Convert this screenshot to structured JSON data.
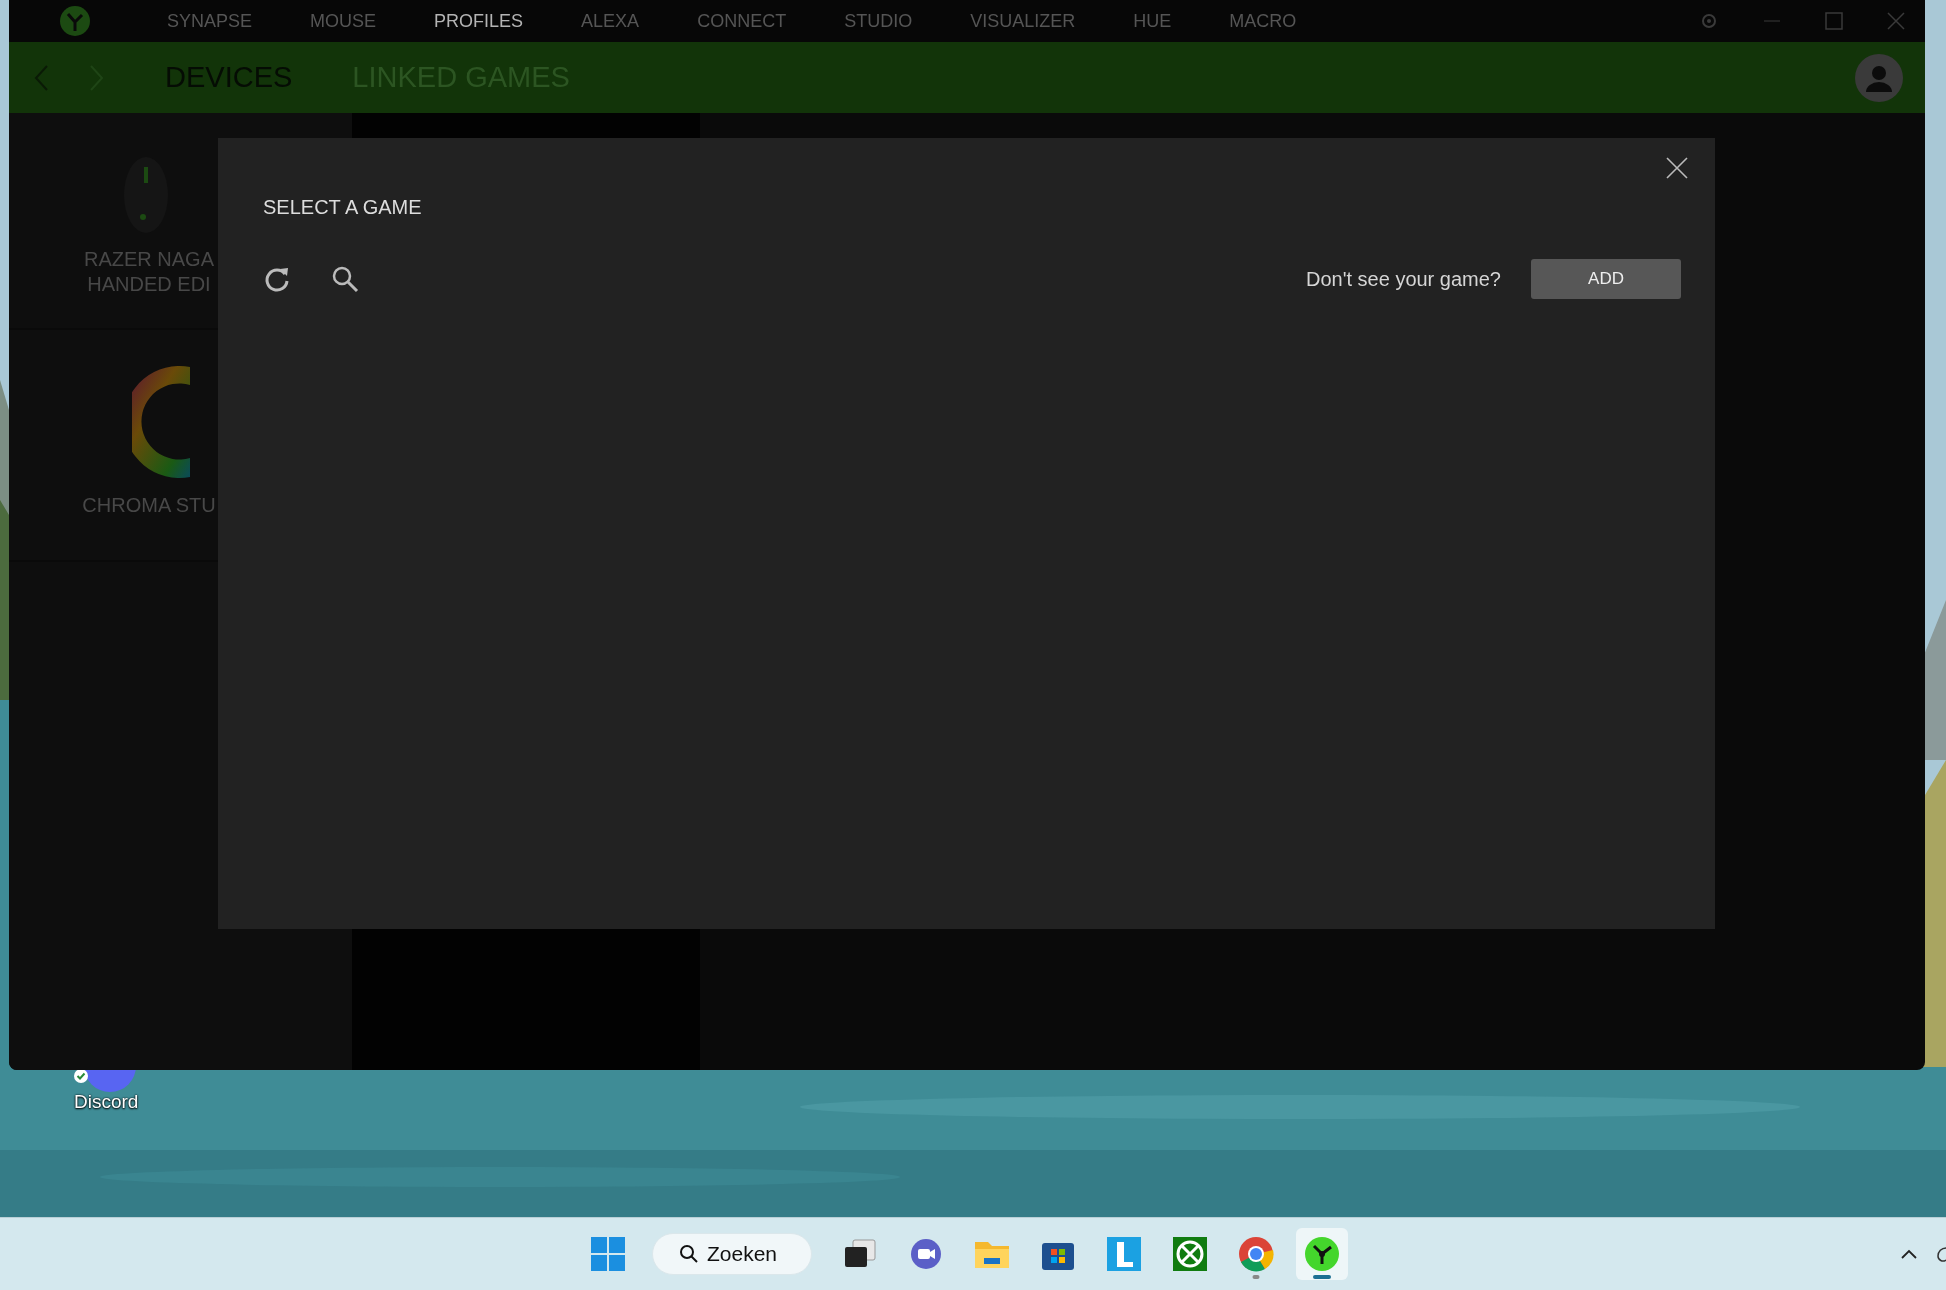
{
  "window": {
    "nav_tabs": [
      {
        "label": "SYNAPSE",
        "selected": false
      },
      {
        "label": "MOUSE",
        "selected": false
      },
      {
        "label": "PROFILES",
        "selected": true
      },
      {
        "label": "ALEXA",
        "selected": false
      },
      {
        "label": "CONNECT",
        "selected": false
      },
      {
        "label": "STUDIO",
        "selected": false
      },
      {
        "label": "VISUALIZER",
        "selected": false
      },
      {
        "label": "HUE",
        "selected": false
      },
      {
        "label": "MACRO",
        "selected": false
      }
    ],
    "sub_tabs": [
      {
        "label": "DEVICES",
        "selected": true
      },
      {
        "label": "LINKED GAMES",
        "selected": false
      }
    ]
  },
  "devices": [
    {
      "kind": "mouse",
      "label": "RAZER NAGA HANDED EDI"
    },
    {
      "kind": "chroma",
      "label": "CHROMA STU"
    }
  ],
  "dialog": {
    "title": "SELECT A GAME",
    "prompt": "Don't see your game?",
    "add_button": "ADD"
  },
  "desktop": {
    "icons": [
      {
        "label": "Discord"
      }
    ]
  },
  "taskbar": {
    "search": "Zoeken",
    "apps": [
      {
        "kind": "taskview",
        "selected": false,
        "running": false
      },
      {
        "kind": "meet",
        "selected": false,
        "running": false
      },
      {
        "kind": "folder",
        "selected": false,
        "running": false
      },
      {
        "kind": "store",
        "selected": false,
        "running": false
      },
      {
        "kind": "letter",
        "selected": false,
        "running": false
      },
      {
        "kind": "xbox",
        "selected": false,
        "running": false
      },
      {
        "kind": "chrome",
        "selected": false,
        "running": true
      },
      {
        "kind": "razer",
        "selected": true,
        "running": true
      }
    ]
  }
}
